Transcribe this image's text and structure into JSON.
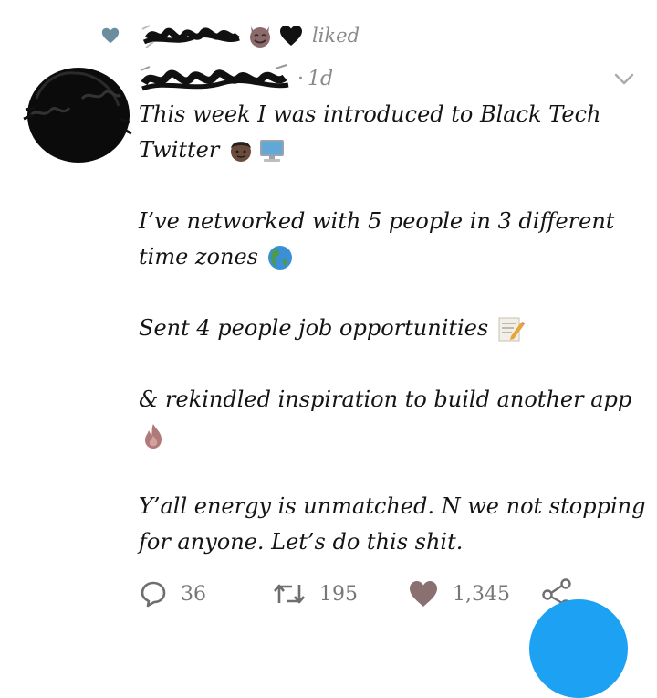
{
  "social_context": {
    "action_text": "liked",
    "icon": "heart-icon",
    "emoji_1": "devil-smile-emoji",
    "emoji_2": "black-heart-emoji"
  },
  "tweet": {
    "timestamp": "1d",
    "menu_icon": "chevron-down-icon",
    "lines": {
      "l1": "This week I was introduced to Black Tech",
      "l2": "Twitter",
      "l3": "I’ve networked with 5 people in 3 different",
      "l4": "time zones",
      "l5": "Sent 4 people job opportunities",
      "l6": "&  rekindled inspiration to build another app",
      "l7": "Y’all energy is unmatched. N we not stopping",
      "l8": "for anyone. Let’s do this shit."
    },
    "emojis": {
      "man_emoji": "man-dark-skin-emoji",
      "computer_emoji": "desktop-computer-emoji",
      "globe_emoji": "globe-americas-emoji",
      "memo_emoji": "memo-emoji",
      "fire_emoji": "fire-emoji"
    }
  },
  "actions": {
    "reply": {
      "icon": "reply-icon",
      "count": "36"
    },
    "retweet": {
      "icon": "retweet-icon",
      "count": "195"
    },
    "like": {
      "icon": "heart-icon",
      "count": "1,345"
    },
    "share": {
      "icon": "share-icon"
    }
  },
  "colors": {
    "liked_heart": "#6b8e9e",
    "like_action_heart": "#8a7070",
    "muted_text": "#8a8a8a",
    "fab_blue": "#1da1f2"
  }
}
